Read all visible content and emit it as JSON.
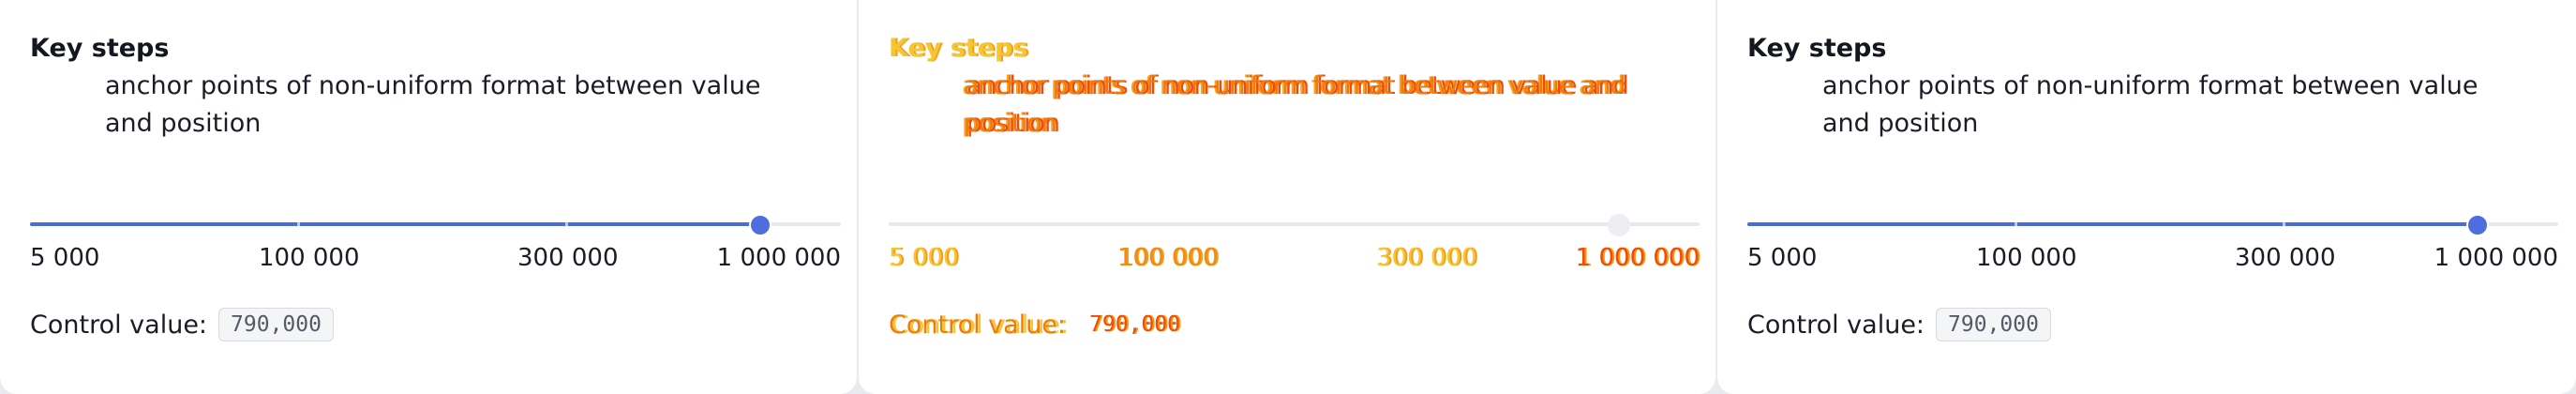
{
  "panels": [
    {
      "heading": "Key steps",
      "description": "anchor points of non-uniform format between value and position",
      "slider_fraction": 0.9,
      "step_labels": [
        "5 000",
        "100 000",
        "300 000",
        "1 000 000"
      ],
      "control_label": "Control value:",
      "control_value": "790,000",
      "colors": {
        "track": "#4b6bd9",
        "thumb": "#4e6ddf"
      }
    },
    {
      "heading": "Key steps",
      "description": "anchor points of non-uniform format between value and position",
      "slider_fraction": 0.9,
      "step_labels": [
        "5 000",
        "100 000",
        "300 000",
        "1 000 000"
      ],
      "control_label": "Control value:",
      "control_value": "790,000",
      "colors": {
        "text": "#f07a0e",
        "thumb": "#eceef2"
      }
    },
    {
      "heading": "Key steps",
      "description": "anchor points of non-uniform format between value and position",
      "slider_fraction": 0.9,
      "step_labels": [
        "5 000",
        "100 000",
        "300 000",
        "1 000 000"
      ],
      "control_label": "Control value:",
      "control_value": "790,000",
      "colors": {
        "track": "#4b6bd9",
        "thumb": "#4e6ddf"
      }
    }
  ]
}
